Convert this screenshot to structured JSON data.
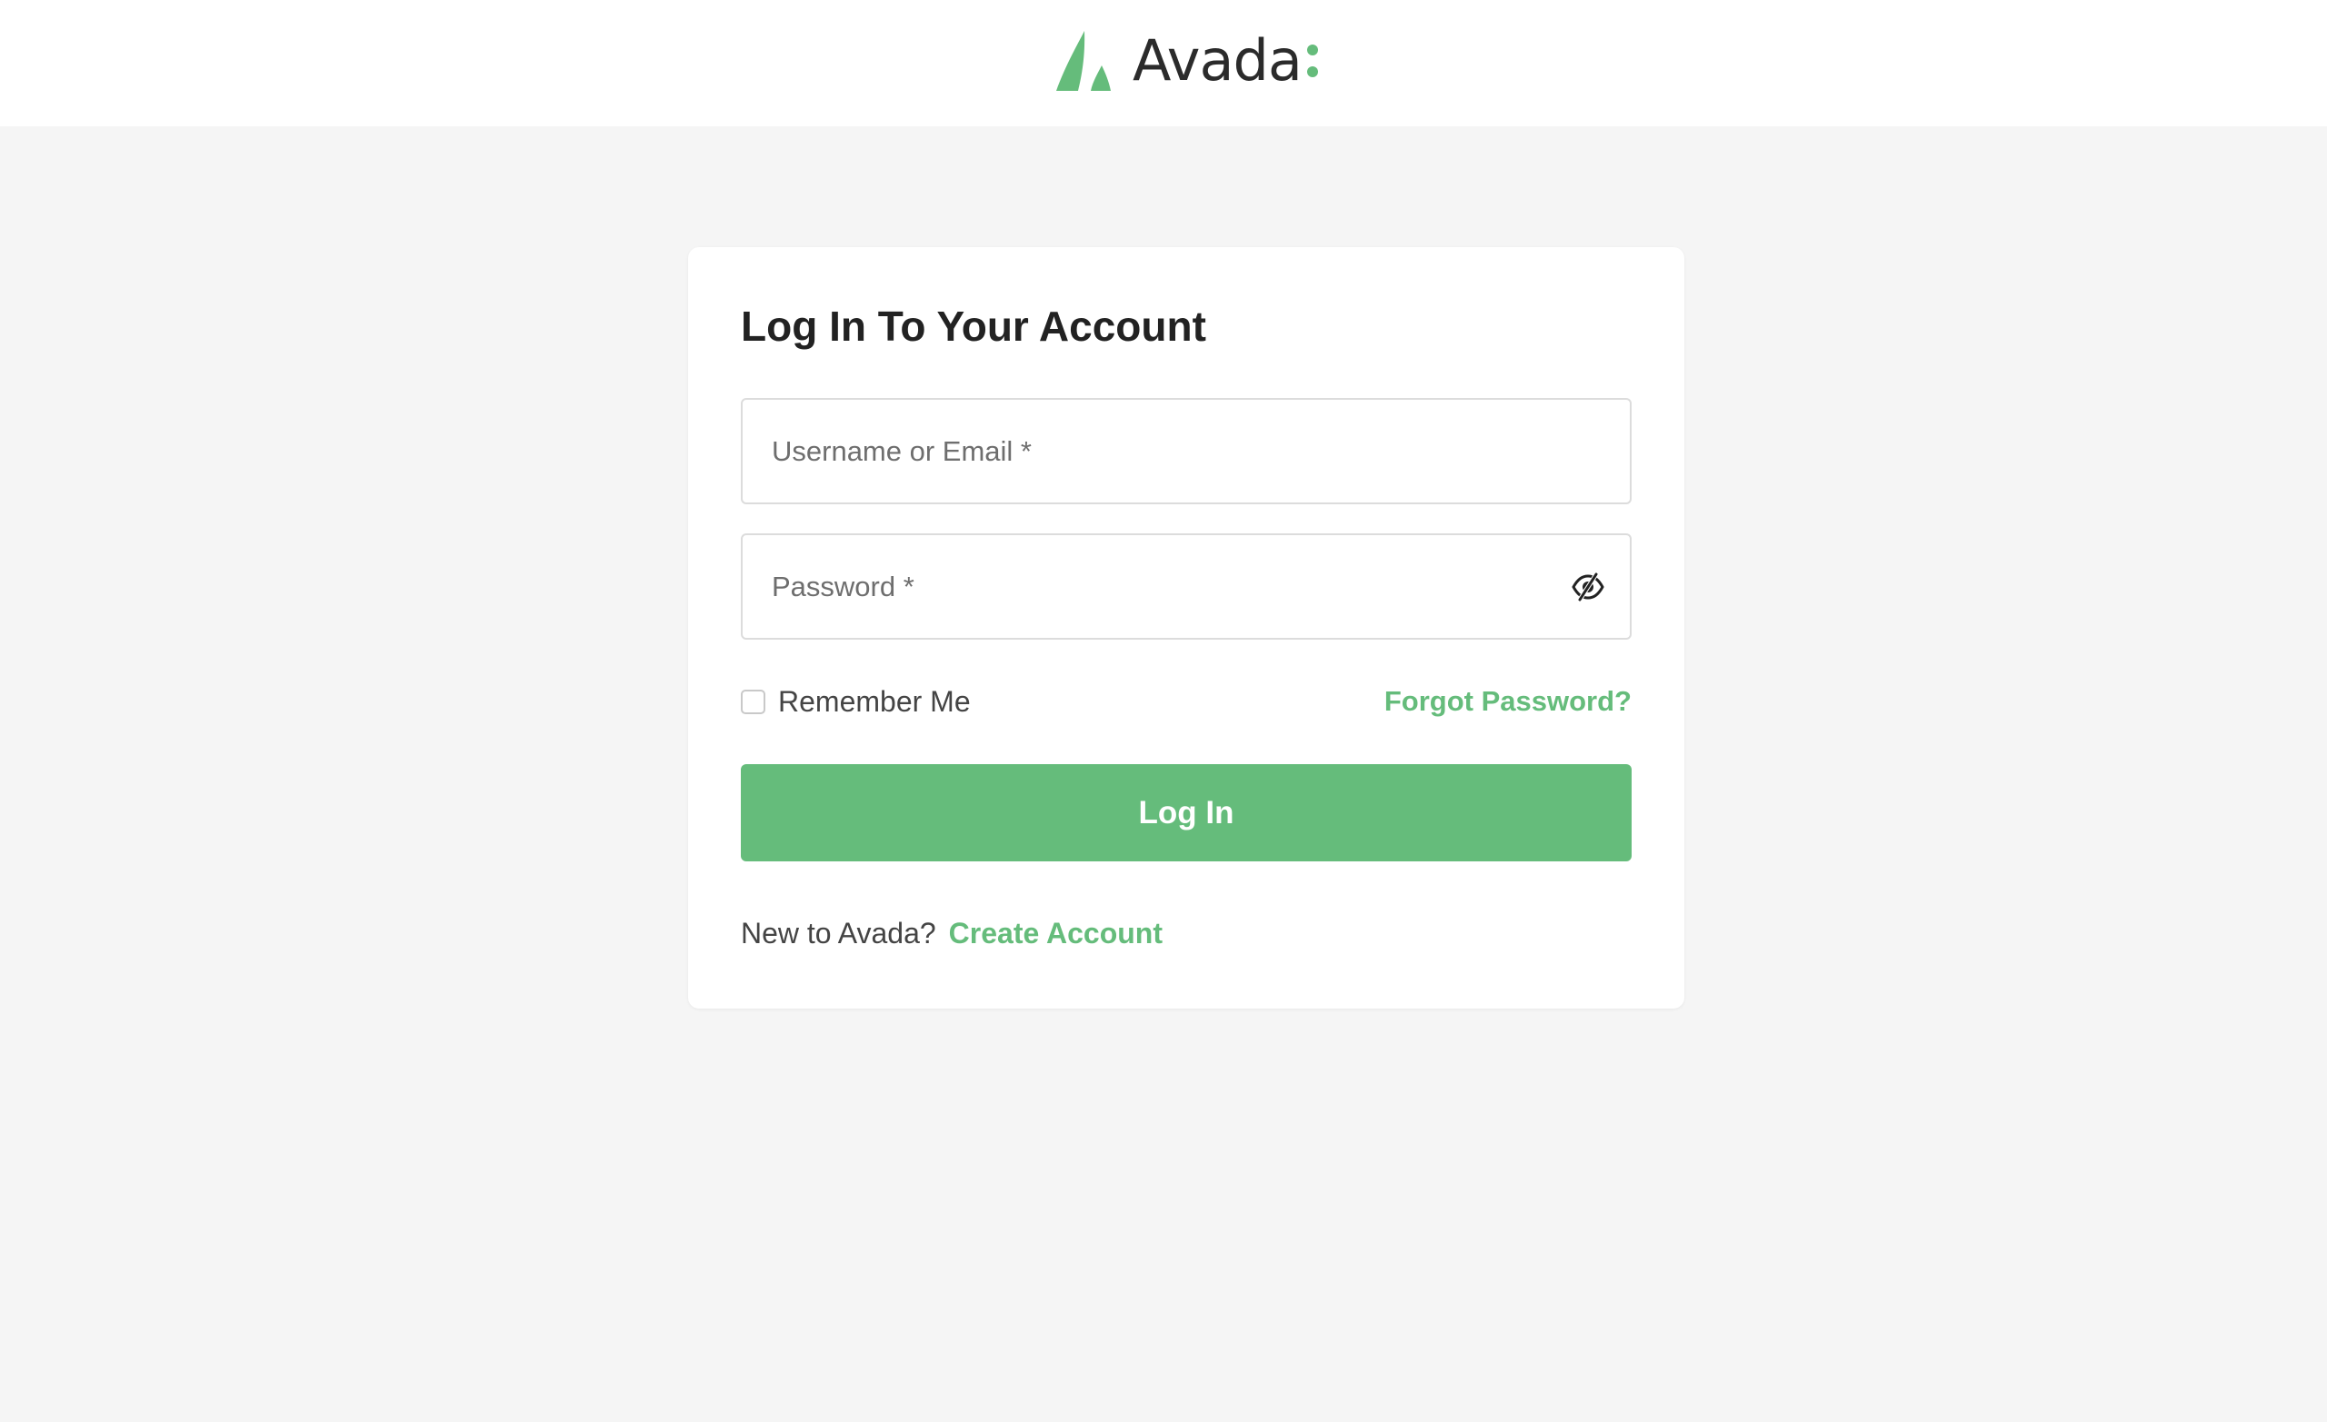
{
  "brand": {
    "logo_text": "Avada",
    "accent_color": "#65bc7b",
    "logo_icon": "avada-leaf-icon"
  },
  "login": {
    "title": "Log In To Your Account",
    "username_placeholder": "Username or Email *",
    "username_value": "",
    "password_placeholder": "Password *",
    "password_value": "",
    "password_toggle_icon": "eye-slash-icon",
    "remember_label": "Remember Me",
    "remember_checked": false,
    "forgot_label": "Forgot Password?",
    "submit_label": "Log In",
    "signup_prompt": "New to Avada?",
    "signup_link": "Create Account"
  },
  "colors": {
    "page_background": "#f5f5f5",
    "card_background": "#ffffff",
    "button_background": "#65bc7b",
    "link_color": "#65bc7b"
  }
}
